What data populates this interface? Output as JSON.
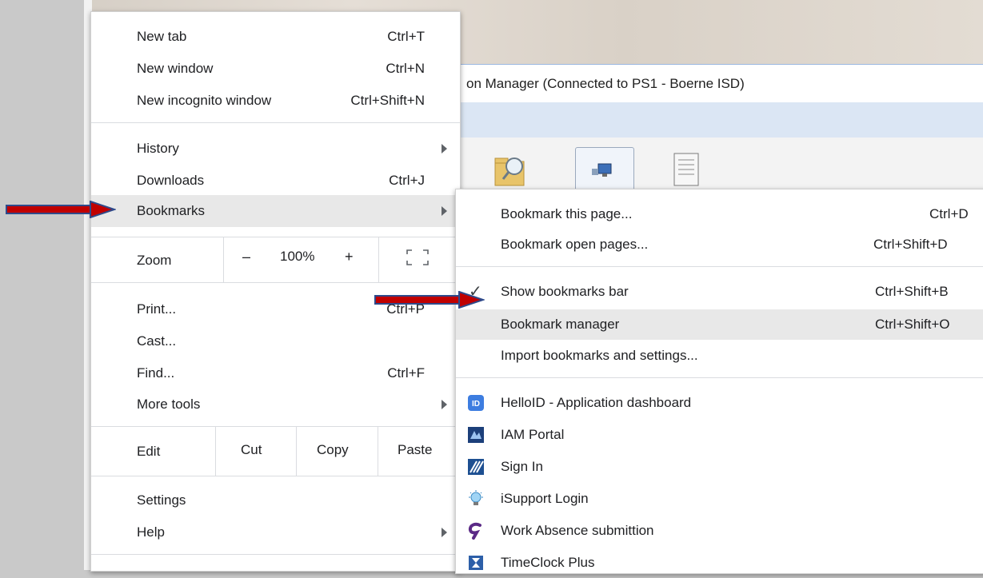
{
  "background_window": {
    "title": "on Manager (Connected to PS1 - Boerne ISD)"
  },
  "main_menu": {
    "new_tab": {
      "label": "New tab",
      "shortcut": "Ctrl+T"
    },
    "new_window": {
      "label": "New window",
      "shortcut": "Ctrl+N"
    },
    "new_incognito": {
      "label": "New incognito window",
      "shortcut": "Ctrl+Shift+N"
    },
    "history": {
      "label": "History"
    },
    "downloads": {
      "label": "Downloads",
      "shortcut": "Ctrl+J"
    },
    "bookmarks": {
      "label": "Bookmarks"
    },
    "zoom": {
      "label": "Zoom",
      "minus": "–",
      "value": "100%",
      "plus": "+"
    },
    "print": {
      "label": "Print...",
      "shortcut": "Ctrl+P"
    },
    "cast": {
      "label": "Cast..."
    },
    "find": {
      "label": "Find...",
      "shortcut": "Ctrl+F"
    },
    "more_tools": {
      "label": "More tools"
    },
    "edit": {
      "label": "Edit",
      "cut": "Cut",
      "copy": "Copy",
      "paste": "Paste"
    },
    "settings": {
      "label": "Settings"
    },
    "help": {
      "label": "Help"
    }
  },
  "bookmarks_menu": {
    "bookmark_page": {
      "label": "Bookmark this page...",
      "shortcut": "Ctrl+D"
    },
    "bookmark_open": {
      "label": "Bookmark open pages...",
      "shortcut": "Ctrl+Shift+D"
    },
    "show_bar": {
      "label": "Show bookmarks bar",
      "shortcut": "Ctrl+Shift+B",
      "checked": true
    },
    "manager": {
      "label": "Bookmark manager",
      "shortcut": "Ctrl+Shift+O"
    },
    "import": {
      "label": "Import bookmarks and settings..."
    },
    "items": [
      {
        "label": "HelloID - Application dashboard",
        "icon": "helloid-icon"
      },
      {
        "label": "IAM Portal",
        "icon": "iam-portal-icon"
      },
      {
        "label": "Sign In",
        "icon": "sign-in-icon"
      },
      {
        "label": "iSupport Login",
        "icon": "lightbulb-icon"
      },
      {
        "label": "Work Absence submittion",
        "icon": "work-absence-icon"
      },
      {
        "label": "TimeClock Plus",
        "icon": "hourglass-icon"
      }
    ]
  },
  "colors": {
    "arrow_fill": "#c00000",
    "arrow_outline": "#2e4a8b",
    "highlight": "#e8e8e8"
  }
}
